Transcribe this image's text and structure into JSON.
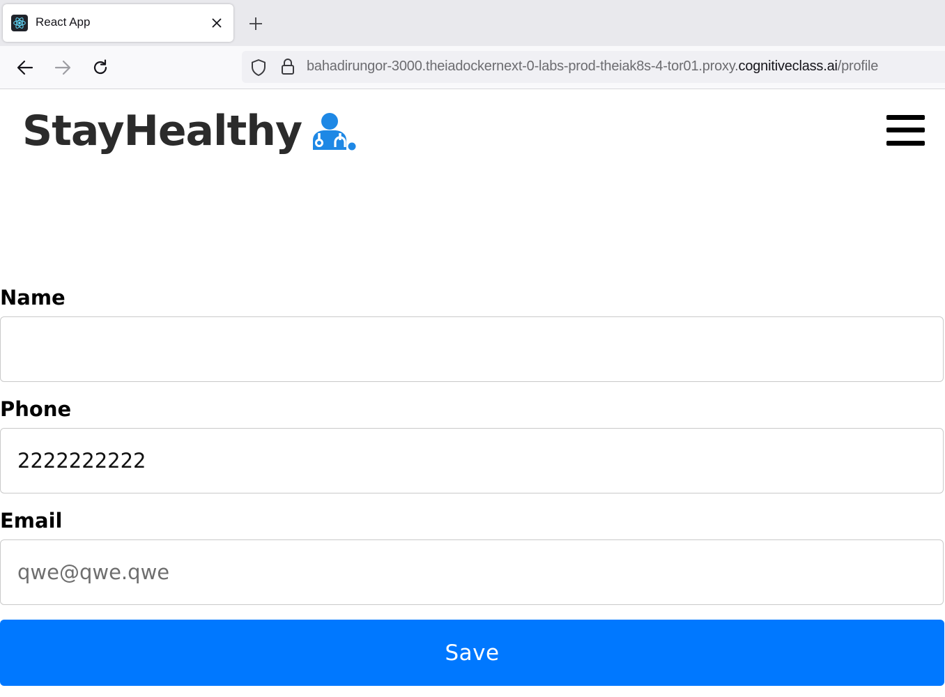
{
  "browser": {
    "tab_title": "React App",
    "url_prefix": "bahadirungor-3000.theiadockernext-0-labs-prod-theiak8s-4-tor01.proxy.",
    "url_domain": "cognitiveclass.ai",
    "url_path": "/profile",
    "icons": {
      "favicon": "react-icon",
      "close": "close-icon",
      "new_tab": "plus-icon",
      "back": "arrow-left-icon",
      "forward": "arrow-right-icon",
      "reload": "reload-icon",
      "shield": "shield-icon",
      "lock": "lock-icon"
    }
  },
  "header": {
    "brand": "StayHealthy",
    "brand_icon": "doctor-icon",
    "menu_icon": "hamburger-menu-icon",
    "accent_color": "#1e88e5"
  },
  "form": {
    "name_label": "Name",
    "name_value": "",
    "phone_label": "Phone",
    "phone_value": "2222222222",
    "email_label": "Email",
    "email_placeholder": "qwe@qwe.qwe",
    "save_label": "Save",
    "button_color": "#0078ff"
  }
}
